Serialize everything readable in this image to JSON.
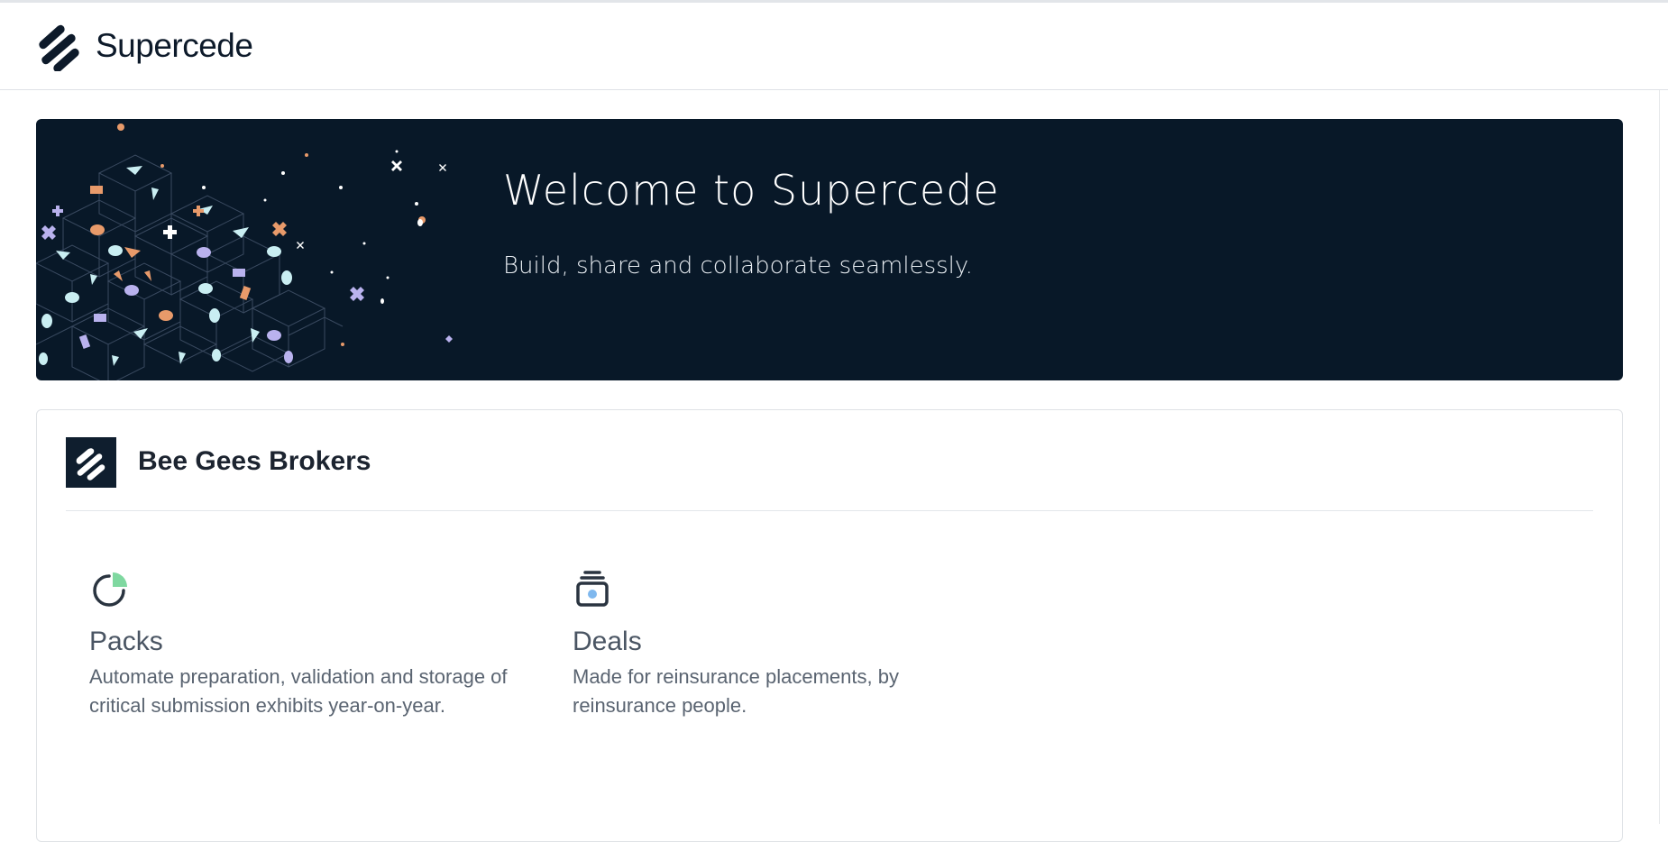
{
  "header": {
    "brand_name": "Supercede",
    "logo_icon": "supercede-logo-icon"
  },
  "hero": {
    "title": "Welcome to Supercede",
    "subtitle": "Build, share and collaborate seamlessly.",
    "background_color": "#081828"
  },
  "organization": {
    "name": "Bee Gees Brokers",
    "logo_icon": "supercede-logo-icon"
  },
  "products": [
    {
      "title": "Packs",
      "description": "Automate preparation, validation and storage of critical submission exhibits year-on-year.",
      "icon": "pie-chart-icon",
      "accent_color": "#7fd8a0"
    },
    {
      "title": "Deals",
      "description": "Made for reinsurance placements, by reinsurance people.",
      "icon": "stack-icon",
      "accent_color": "#7fb8ee"
    }
  ],
  "colors": {
    "text_dark": "#1c2430",
    "orange": "#e89a6a",
    "lavender": "#b9b2ee",
    "cyan": "#c9eef2"
  }
}
